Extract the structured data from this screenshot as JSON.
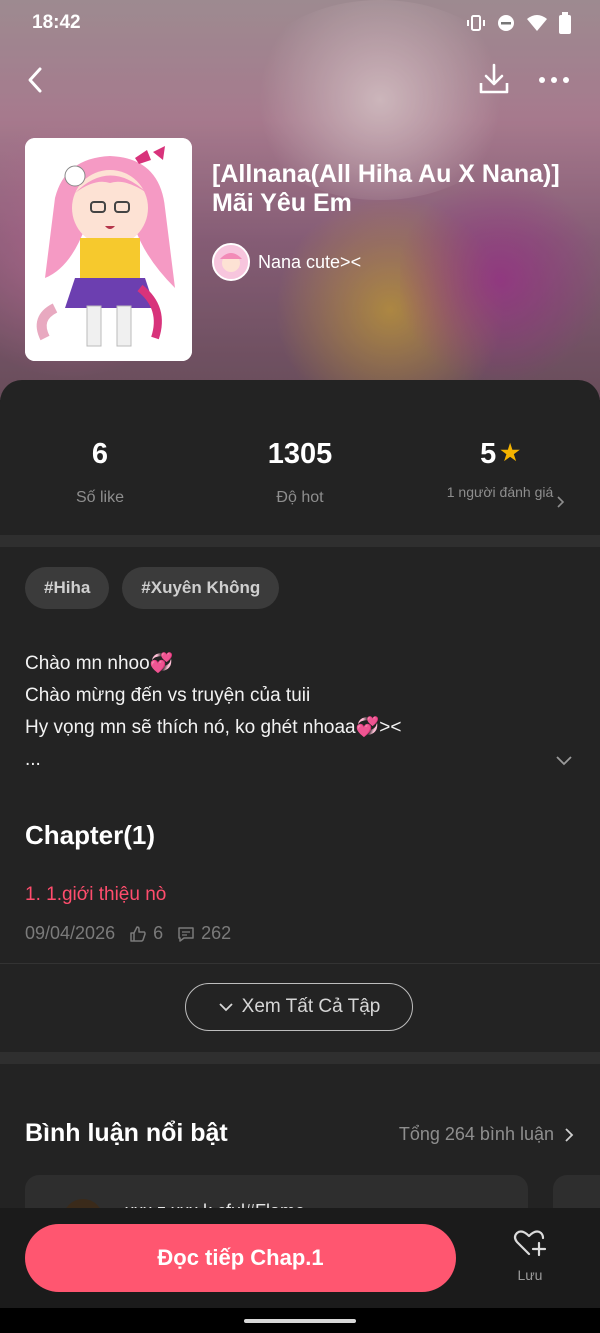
{
  "status": {
    "time": "18:42"
  },
  "story": {
    "title": "[Allnana(All Hiha Au X Nana)] Mãi Yêu Em",
    "author": "Nana cute><"
  },
  "stats": {
    "likes_value": "6",
    "likes_label": "Số like",
    "hot_value": "1305",
    "hot_label": "Độ hot",
    "rating_value": "5",
    "rating_label": "1 người đánh giá"
  },
  "tags": [
    "#Hiha",
    "#Xuyên Không"
  ],
  "description": {
    "line1": "Chào mn nhoo",
    "line2": "Chào mừng đến vs truyện của tuii",
    "line3": "Hy vọng mn sẽ thích nó, ko ghét nhoaa",
    "line3_suffix": "><",
    "line4": "..."
  },
  "chapters": {
    "heading": "Chapter(1)",
    "items": [
      {
        "title": "1. 1.giới thiệu nò",
        "date": "09/04/2026",
        "likes": "6",
        "comments": "262"
      }
    ],
    "see_all_label": "Xem Tất Cả Tập"
  },
  "comments": {
    "heading": "Bình luận nổi bật",
    "total_label": "Tổng 264 bình luận",
    "preview_text": "xxx z xxx k cful#Flame"
  },
  "actions": {
    "read_label": "Đọc tiếp Chap.1",
    "save_label": "Lưu"
  },
  "colors": {
    "accent": "#ff5670",
    "chapter_link": "#ff4d6d",
    "star": "#f5b400"
  }
}
